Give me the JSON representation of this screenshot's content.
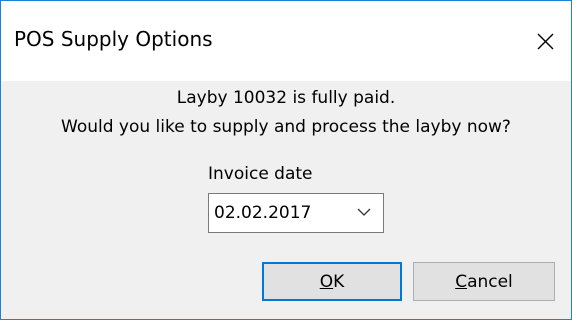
{
  "window": {
    "title": "POS Supply Options",
    "close_icon": "close-icon"
  },
  "message": {
    "line1": "Layby 10032 is fully paid.",
    "line2": "Would you like to supply and process the layby now?"
  },
  "invoice_date": {
    "label": "Invoice date",
    "value": "02.02.2017",
    "dropdown_icon": "chevron-down-icon"
  },
  "buttons": {
    "ok": {
      "mnemonic": "O",
      "rest": "K"
    },
    "cancel": {
      "mnemonic": "C",
      "rest": "ancel"
    }
  },
  "colors": {
    "accent": "#0078d7",
    "window_border": "#1883d7",
    "client_background": "#f0f0f0",
    "button_face": "#e1e1e1"
  }
}
